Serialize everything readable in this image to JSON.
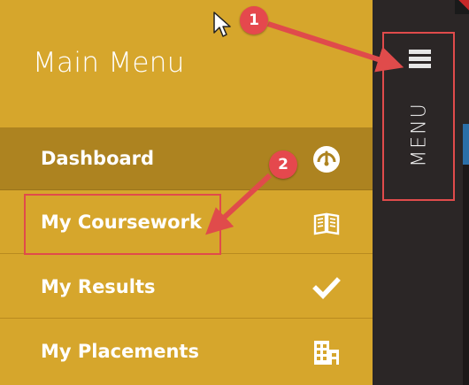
{
  "menu": {
    "title": "Main Menu",
    "items": [
      {
        "label": "Dashboard",
        "icon": "speedometer-icon",
        "active": true
      },
      {
        "label": "My Coursework",
        "icon": "open-book-icon",
        "active": false
      },
      {
        "label": "My Results",
        "icon": "checkmark-icon",
        "active": false
      },
      {
        "label": "My Placements",
        "icon": "building-icon",
        "active": false
      }
    ]
  },
  "sidebar": {
    "menu_label": "MENU",
    "icon": "hamburger-icon"
  },
  "annotations": {
    "badge1": "1",
    "badge2": "2",
    "color": "#e04b4b"
  },
  "colors": {
    "panel": "#d6a62c",
    "active_item": "#ad8320",
    "sidebar": "#2b2626",
    "text": "#ffffff"
  }
}
